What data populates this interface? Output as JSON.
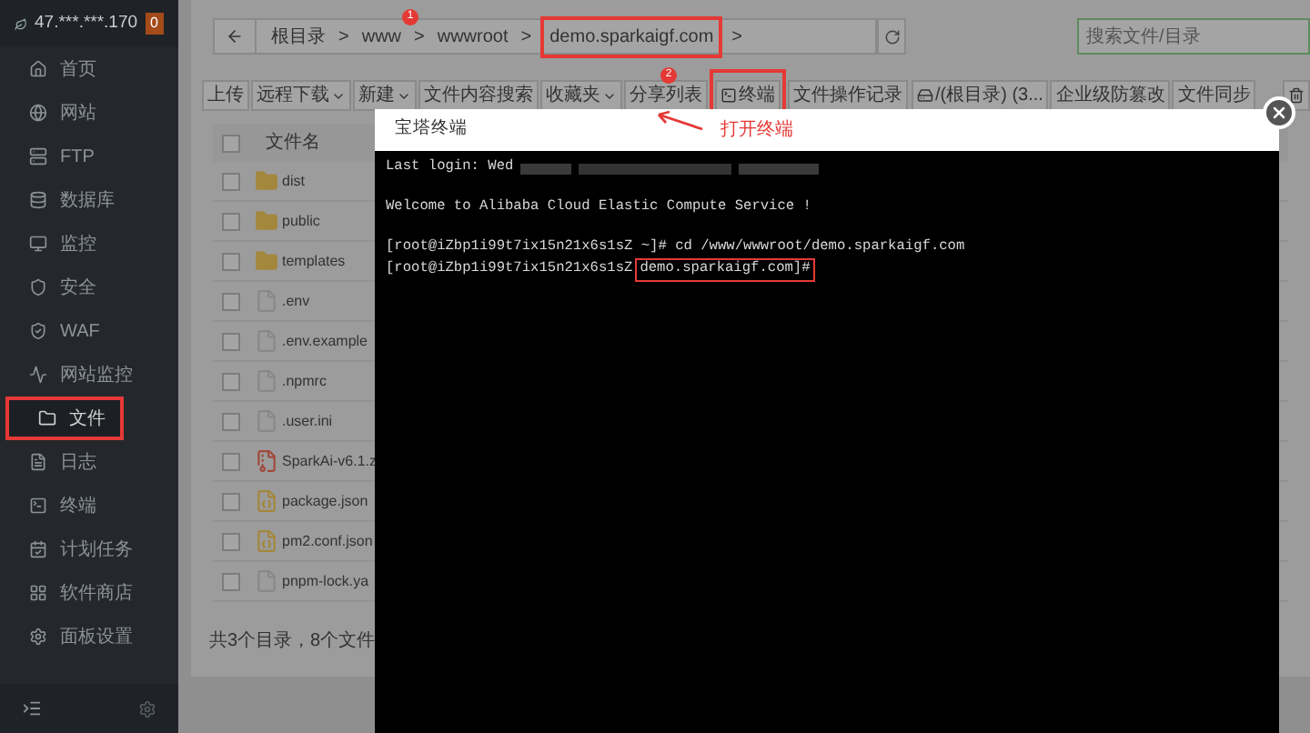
{
  "server": {
    "ip": "47.***.***.170",
    "badge": "0"
  },
  "sidebar": {
    "items": [
      {
        "label": "首页",
        "selected": false,
        "annotated": false
      },
      {
        "label": "网站",
        "selected": false,
        "annotated": false
      },
      {
        "label": "FTP",
        "selected": false,
        "annotated": false
      },
      {
        "label": "数据库",
        "selected": false,
        "annotated": false
      },
      {
        "label": "监控",
        "selected": false,
        "annotated": false
      },
      {
        "label": "安全",
        "selected": false,
        "annotated": false
      },
      {
        "label": "WAF",
        "selected": false,
        "annotated": false
      },
      {
        "label": "网站监控",
        "selected": false,
        "annotated": false
      },
      {
        "label": "文件",
        "selected": true,
        "annotated": true
      },
      {
        "label": "日志",
        "selected": false,
        "annotated": false
      },
      {
        "label": "终端",
        "selected": false,
        "annotated": false
      },
      {
        "label": "计划任务",
        "selected": false,
        "annotated": false
      },
      {
        "label": "软件商店",
        "selected": false,
        "annotated": false
      },
      {
        "label": "面板设置",
        "selected": false,
        "annotated": false
      }
    ]
  },
  "breadcrumb": {
    "items": [
      {
        "label": "根目录",
        "annotated": false
      },
      {
        "label": "www",
        "annotated": false
      },
      {
        "label": "wwwroot",
        "annotated": false
      },
      {
        "label": "demo.sparkaigf.com",
        "annotated": true
      }
    ],
    "separator": ">"
  },
  "search": {
    "placeholder": "搜索文件/目录"
  },
  "toolbar": [
    {
      "label": "上传",
      "kind": "plain",
      "annotated": false
    },
    {
      "label": "远程下载",
      "kind": "dropdown",
      "annotated": false
    },
    {
      "label": "新建",
      "kind": "dropdown",
      "annotated": false
    },
    {
      "label": "文件内容搜索",
      "kind": "plain",
      "annotated": false
    },
    {
      "label": "收藏夹",
      "kind": "dropdown",
      "annotated": false
    },
    {
      "label": "分享列表",
      "kind": "plain",
      "annotated": false
    },
    {
      "label": "终端",
      "kind": "terminal",
      "annotated": true
    },
    {
      "label": "文件操作记录",
      "kind": "plain",
      "annotated": false
    },
    {
      "label": "/(根目录) (3...",
      "kind": "disk",
      "annotated": false
    },
    {
      "label": "企业级防篡改",
      "kind": "plain",
      "annotated": false
    },
    {
      "label": "文件同步",
      "kind": "plain",
      "annotated": false
    }
  ],
  "table": {
    "columns": [
      "文件名"
    ],
    "header_checked": false,
    "rows": [
      {
        "name": "dist",
        "kind": "folder",
        "checked": false
      },
      {
        "name": "public",
        "kind": "folder",
        "checked": false
      },
      {
        "name": "templates",
        "kind": "folder",
        "checked": false
      },
      {
        "name": ".env",
        "kind": "file",
        "checked": false
      },
      {
        "name": ".env.example",
        "kind": "file",
        "checked": false
      },
      {
        "name": ".npmrc",
        "kind": "file",
        "checked": false
      },
      {
        "name": ".user.ini",
        "kind": "file",
        "checked": false
      },
      {
        "name": "SparkAi-v6.1.z",
        "kind": "zip",
        "checked": false
      },
      {
        "name": "package.json",
        "kind": "json",
        "checked": false
      },
      {
        "name": "pm2.conf.json",
        "kind": "json",
        "checked": false
      },
      {
        "name": "pnpm-lock.ya",
        "kind": "file",
        "checked": false
      }
    ],
    "summary": "共3个目录，8个文件"
  },
  "terminal": {
    "title": "宝塔终端",
    "lines": [
      {
        "kind": "login",
        "text": "Last login: Wed"
      },
      {
        "kind": "blank"
      },
      {
        "kind": "text",
        "text": "Welcome to Alibaba Cloud Elastic Compute Service !"
      },
      {
        "kind": "blank"
      },
      {
        "kind": "text",
        "text": "[root@iZbp1i99t7ix15n21x6s1sZ ~]# cd /www/wwwroot/demo.sparkaigf.com"
      },
      {
        "kind": "prompt",
        "text": "[root@iZbp1i99t7ix15n21x6s1sZ",
        "highlight": "demo.sparkaigf.com]#"
      }
    ]
  },
  "annotations": {
    "step_1": "1",
    "step_2": "2",
    "callout": "打开终端"
  }
}
